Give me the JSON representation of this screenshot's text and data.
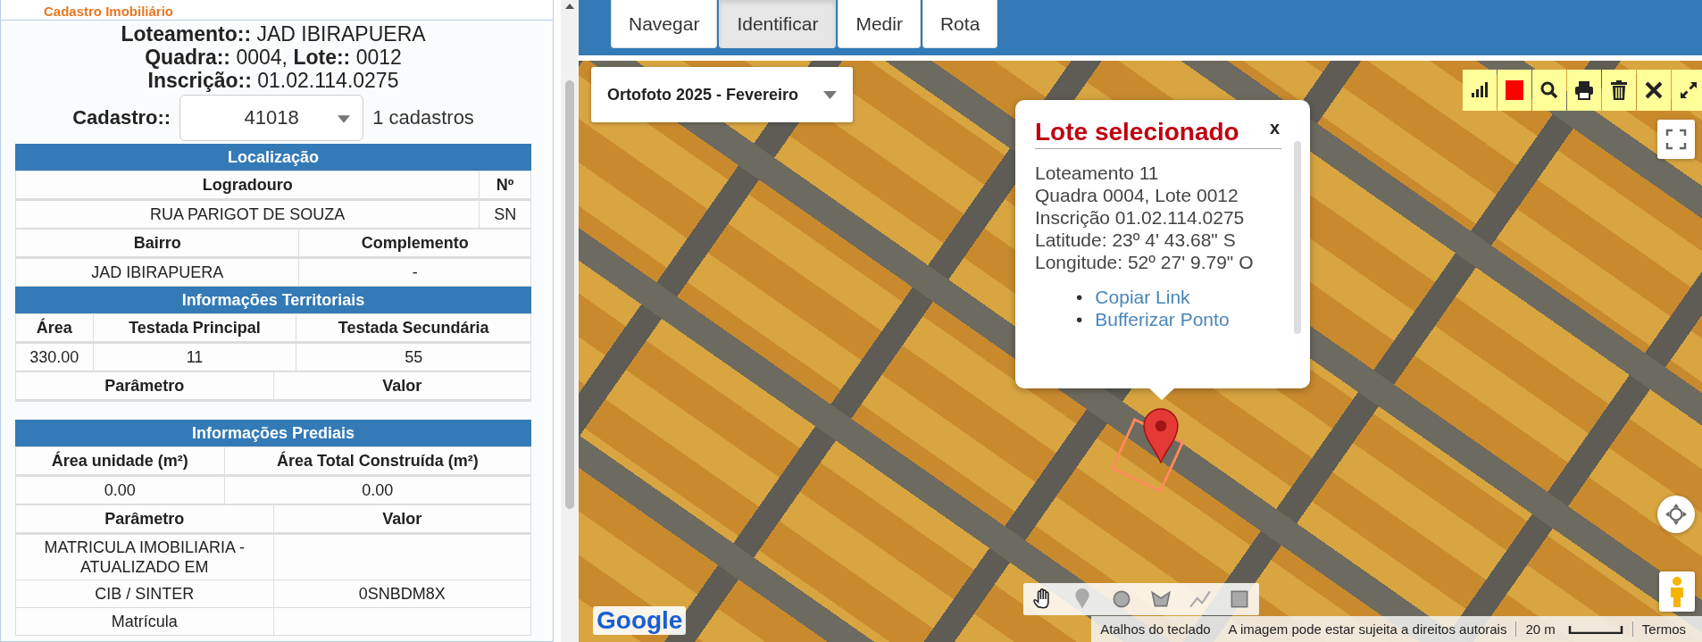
{
  "panel": {
    "title": "Cadastro Imobiliário",
    "summary": [
      "**Loteamento::** JAD IBIRAPUERA",
      "**Quadra::** 0004, **Lote::** 0012",
      "**Inscrição::** 01.02.114.0275"
    ],
    "cadastro": {
      "label": "Cadastro::",
      "value": "41018",
      "count": "1 cadastros"
    },
    "sections": [
      {
        "title": "Localização",
        "tables": [
          {
            "columns": [
              "Logradouro",
              "Nº"
            ],
            "rows": [
              [
                "RUA PARIGOT DE SOUZA",
                "SN"
              ]
            ]
          },
          {
            "columns": [
              "Bairro",
              "Complemento"
            ],
            "rows": [
              [
                "JAD IBIRAPUERA",
                "-"
              ]
            ]
          }
        ]
      },
      {
        "title": "Informações Territoriais",
        "tables": [
          {
            "columns": [
              "Área",
              "Testada Principal",
              "Testada Secundária"
            ],
            "rows": [
              [
                "330.00",
                "11",
                "55"
              ]
            ]
          },
          {
            "columns": [
              "Parâmetro",
              "Valor"
            ]
          }
        ]
      },
      {
        "title": "Informações Prediais",
        "tables": [
          {
            "columns": [
              "Área unidade (m²)",
              "Área Total Construída (m²)"
            ],
            "rows": [
              [
                "0.00",
                "0.00"
              ]
            ]
          },
          {
            "columns": [
              "Parâmetro",
              "Valor"
            ],
            "rows": [
              [
                "MATRICULA IMOBILIARIA - ATUALIZADO EM",
                null
              ],
              [
                "CIB / SINTER",
                "0SNBDM8X"
              ],
              [
                "Matrícula",
                null
              ]
            ]
          }
        ]
      }
    ]
  },
  "map": {
    "toolbar": [
      {
        "label": "Navegar",
        "selected": false
      },
      {
        "label": "Identificar",
        "selected": true
      },
      {
        "label": "Medir",
        "selected": false
      },
      {
        "label": "Rota",
        "selected": false
      }
    ],
    "layer_select": {
      "value": "Ortofoto 2025 - Fevereiro"
    },
    "popup": {
      "title": "Lote selecionado",
      "close": "x",
      "lines": [
        "Loteamento 11",
        "Quadra 0004, Lote 0012",
        "Inscrição 01.02.114.0275",
        "Latitude: 23º 4' 43.68\" S",
        "Longitude: 52º 27' 9.79\" O"
      ],
      "links": [
        {
          "bullet": "•",
          "label": "Copiar Link"
        },
        {
          "bullet": "•",
          "label": "Bufferizar Ponto"
        }
      ]
    },
    "drawing_tools": [
      {
        "kind": "hand",
        "selected": true
      },
      {
        "kind": "marker",
        "selected": false
      },
      {
        "kind": "circle",
        "selected": false
      },
      {
        "kind": "polygon",
        "selected": false
      },
      {
        "kind": "line",
        "selected": false
      },
      {
        "kind": "rectangle",
        "selected": false
      }
    ],
    "logo": "Google",
    "footer": {
      "shortcuts": "Atalhos do teclado",
      "copyright": "A imagem pode estar sujeita a direitos autorais",
      "scale": "20 m",
      "terms": "Termos"
    }
  }
}
